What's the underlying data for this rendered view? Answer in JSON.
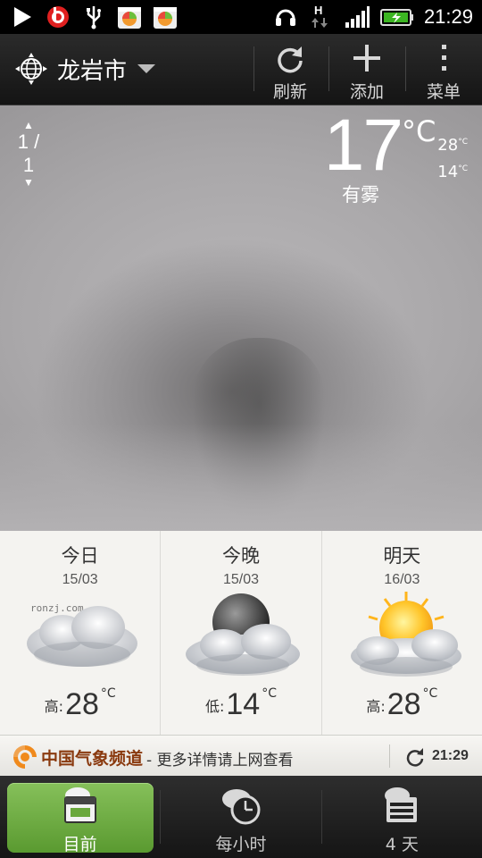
{
  "status_bar": {
    "time": "21:29",
    "network": "H"
  },
  "toolbar": {
    "location": "龙岩市",
    "refresh": "刷新",
    "add": "添加",
    "menu": "菜单"
  },
  "current": {
    "page": "1 / 1",
    "temp": "17",
    "unit": "°C",
    "high": "28",
    "low": "14",
    "small_unit": "°C",
    "condition": "有雾"
  },
  "forecast": [
    {
      "name": "今日",
      "date": "15/03",
      "label": "高:",
      "temp": "28",
      "unit": "°C",
      "icon": "cloudy-icon"
    },
    {
      "name": "今晚",
      "date": "15/03",
      "label": "低:",
      "temp": "14",
      "unit": "°C",
      "icon": "cloudy-night-icon"
    },
    {
      "name": "明天",
      "date": "16/03",
      "label": "高:",
      "temp": "28",
      "unit": "°C",
      "icon": "partly-sunny-icon"
    }
  ],
  "watermark": "ronzj.com",
  "source": {
    "brand": "中国气象频道",
    "more": "- 更多详情请上网查看",
    "updated": "21:29"
  },
  "tabs": [
    {
      "label": "目前",
      "icon": "calendar-cloud-icon",
      "active": true
    },
    {
      "label": "每小时",
      "icon": "clock-cloud-icon",
      "active": false
    },
    {
      "label": "4 天",
      "icon": "four-day-cloud-icon",
      "active": false
    }
  ]
}
